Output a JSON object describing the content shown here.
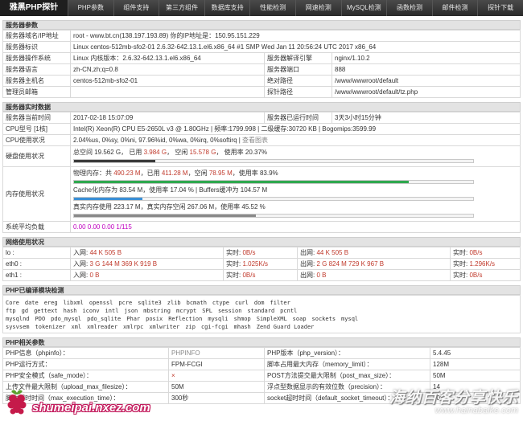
{
  "nav": {
    "brand": "雅黑PHP探针",
    "items": [
      "PHP参数",
      "组件支持",
      "第三方组件",
      "数据库支持",
      "性能检测",
      "网速检测",
      "MySQL检测",
      "函数检测",
      "邮件检测",
      "探针下载"
    ]
  },
  "server_params": {
    "title": "服务器参数",
    "domain_label": "服务器域名/IP地址",
    "domain_value": "root - www.bt.cn(138.197.193.89)  你的IP地址是：150.95.151.229",
    "id_label": "服务器标识",
    "id_value": "Linux centos-512mb-sfo2-01 2.6.32-642.13.1.el6.x86_64 #1 SMP Wed Jan 11 20:56:24 UTC 2017 x86_64",
    "os_label": "服务器操作系统",
    "os_value": "Linux  内核版本：2.6.32-642.13.1.el6.x86_64",
    "engine_label": "服务器解译引擎",
    "engine_value": "nginx/1.10.2",
    "lang_label": "服务器语言",
    "lang_value": "zh-CN,zh;q=0.8",
    "port_label": "服务器端口",
    "port_value": "888",
    "host_label": "服务器主机名",
    "host_value": "centos-512mb-sfo2-01",
    "abspath_label": "绝对路径",
    "abspath_value": "/www/wwwroot/default",
    "admin_label": "管理员邮箱",
    "admin_value": "",
    "probe_label": "探针路径",
    "probe_value": "/www/wwwroot/default/tz.php"
  },
  "realtime": {
    "title": "服务器实时数据",
    "time_label": "服务器当前时间",
    "time_value": "2017-02-18 15:07:09",
    "uptime_label": "服务器已运行时间",
    "uptime_value": "3天3小时15分钟",
    "cpu_label": "CPU型号 [1核]",
    "cpu_value": "Intel(R) Xeon(R) CPU E5-2650L v3 @ 1.80GHz | 频率:1799.998 | 二级缓存:30720 KB | Bogomips:3599.99",
    "cpuuse_label": "CPU使用状况",
    "cpuuse_value": "2.04%us, 0%sy, 0%ni, 97.96%id, 0%wa, 0%irq, 0%softirq",
    "cpuuse_link": "查看图表",
    "disk_label": "硬盘使用状况",
    "disk_prefix": "总空间 19.562 G，  已用",
    "disk_used": "3.984 G",
    "disk_mid": "，  空闲",
    "disk_free": "15.578 G",
    "disk_suffix": "，  使用率 20.37%",
    "disk_pct": 20.37,
    "mem_label": "内存使用状况",
    "mem_phys_prefix": "物理内存：共",
    "mem_phys_total": "490.23 M",
    "mem_phys_mid1": "，已用",
    "mem_phys_used": "411.28 M",
    "mem_phys_mid2": "，空闲",
    "mem_phys_free": "78.95 M",
    "mem_phys_suffix": "，使用率 83.9%",
    "mem_phys_pct": 83.9,
    "mem_cache_text": "Cache化内存为 83.54 M，使用率 17.04 % | Buffers缓冲为 104.57 M",
    "mem_cache_pct": 17.04,
    "mem_real_text": "真实内存使用 223.17 M，真实内存空闲 267.06 M，使用率 45.52 %",
    "mem_real_pct": 45.52,
    "load_label": "系统平均负载",
    "load_value": "0.00 0.00 0.00 1/115"
  },
  "network": {
    "title": "网络使用状况",
    "rows": [
      {
        "name": "lo :",
        "in_label": "入网:",
        "in_val": "44 K 505 B",
        "rt_in_label": "实时:",
        "rt_in": "0B/s",
        "out_label": "出网:",
        "out_val": "44 K 505 B",
        "rt_out_label": "实时:",
        "rt_out": "0B/s"
      },
      {
        "name": "eth0 :",
        "in_label": "入网:",
        "in_val": "3 G 144 M 369 K 919 B",
        "rt_in_label": "实时:",
        "rt_in": "1.025K/s",
        "out_label": "出网:",
        "out_val": "2 G 824 M 729 K 967 B",
        "rt_out_label": "实时:",
        "rt_out": "1.296K/s"
      },
      {
        "name": "eth1 :",
        "in_label": "入网:",
        "in_val": "0 B",
        "rt_in_label": "实时:",
        "rt_in": "0B/s",
        "out_label": "出网:",
        "out_val": "0 B",
        "rt_out_label": "实时:",
        "rt_out": "0B/s"
      }
    ]
  },
  "modules": {
    "title": "PHP已编译模块检测",
    "lines": [
      [
        "Core",
        "date",
        "ereg",
        "libxml",
        "openssl",
        "pcre",
        "sqlite3",
        "zlib",
        "bcmath",
        "ctype",
        "curl",
        "dom",
        "filter"
      ],
      [
        "ftp",
        "gd",
        "gettext",
        "hash",
        "iconv",
        "intl",
        "json",
        "mbstring",
        "mcrypt",
        "SPL",
        "session",
        "standard",
        "pcntl"
      ],
      [
        "mysqlnd",
        "PDO",
        "pdo_mysql",
        "pdo_sqlite",
        "Phar",
        "posix",
        "Reflection",
        "mysqli",
        "shmop",
        "SimpleXML",
        "soap",
        "sockets",
        "mysql"
      ],
      [
        "sysvsem",
        "tokenizer",
        "xml",
        "xmlreader",
        "xmlrpc",
        "xmlwriter",
        "zip",
        "cgi-fcgi",
        "mhash",
        "Zend Guard Loader"
      ]
    ]
  },
  "php": {
    "title": "PHP相关参数",
    "rows": [
      {
        "l1": "PHP信息（phpinfo）：",
        "v1": "PHPINFO",
        "l2": "PHP版本（php_version）：",
        "v2": "5.4.45"
      },
      {
        "l1": "PHP运行方式：",
        "v1": "FPM-FCGI",
        "l2": "脚本占用最大内存（memory_limit）：",
        "v2": "128M"
      },
      {
        "l1": "PHP安全模式（safe_mode）：",
        "v1": "×",
        "l2": "POST方法提交最大限制（post_max_size）：",
        "v2": "50M"
      },
      {
        "l1": "上传文件最大限制（upload_max_filesize）：",
        "v1": "50M",
        "l2": "浮点型数据显示的有效位数（precision）：",
        "v2": "14"
      },
      {
        "l1": "脚本超时时间（max_execution_time）：",
        "v1": "300秒",
        "l2": "socket超时时间（default_socket_timeout）：",
        "v2": "60秒"
      }
    ]
  },
  "watermark": {
    "left": "shumeipai.nxez.com",
    "right_1": "海纳百客分享快乐",
    "right_2": "www.hainabaike.com"
  },
  "colors": {
    "disk_bar": "#3a3a3a",
    "mem_phys_bar": "#2fa84f",
    "mem_cache_bar": "#3a8fd6",
    "mem_real_bar": "#8a8a8a"
  }
}
